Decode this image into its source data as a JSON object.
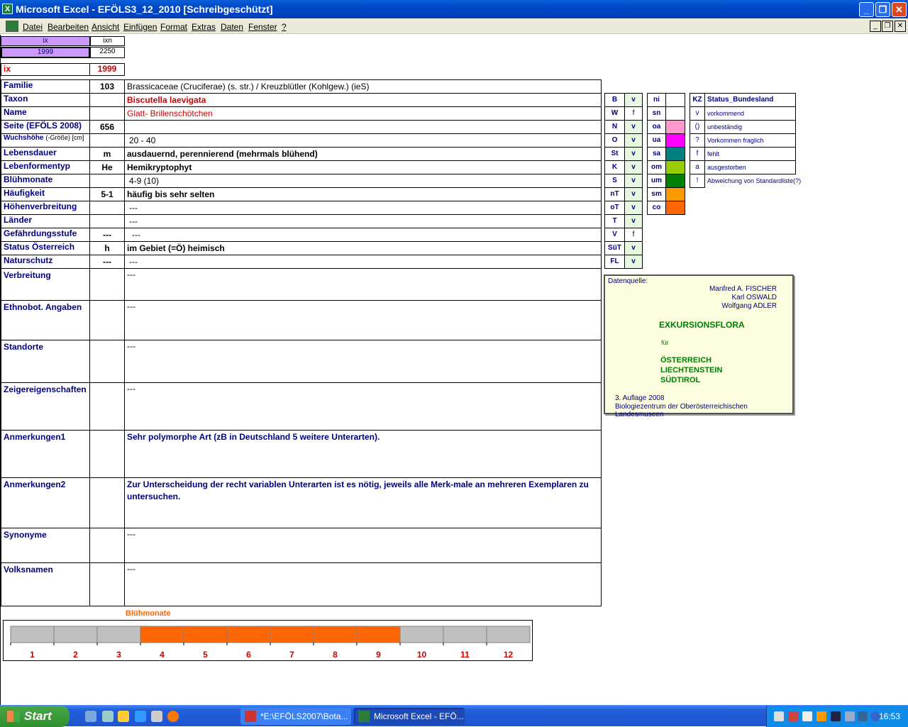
{
  "window": {
    "title": "Microsoft Excel - EFÖLS3_12_2010  [Schreibgeschützt]"
  },
  "menu": [
    "Datei",
    "Bearbeiten",
    "Ansicht",
    "Einfügen",
    "Format",
    "Extras",
    "Daten",
    "Fenster",
    "?"
  ],
  "header": {
    "ix_label": "ix",
    "ixn_label": "ixn",
    "ix_value": "1999",
    "ixn_value": "2250",
    "ix_big_label": "ix",
    "ix_big_value": "1999"
  },
  "rows": [
    {
      "label": "Familie",
      "code": "103",
      "value": "Brassicaceae (Cruciferae) (s. str.)  /  Kreuzblütler (Kohlgew.) (ieS)"
    },
    {
      "label": "Taxon",
      "code": "",
      "value": "Biscutella laevigata"
    },
    {
      "label": "Name",
      "code": "",
      "value": "Glatt- Brillenschötchen"
    },
    {
      "label": "Seite (EFÖLS 2008)",
      "code": "656",
      "value": ""
    },
    {
      "label": "Wuchshöhe",
      "label_suffix": "(-Größe) [cm]",
      "code": "",
      "value": "20 - 40"
    },
    {
      "label": "Lebensdauer",
      "code": "m",
      "value": "ausdauernd, perennierend (mehrmals blühend)"
    },
    {
      "label": "Lebenformentyp",
      "code": "He",
      "value": "Hemikryptophyt"
    },
    {
      "label": "Blühmonate",
      "code": "",
      "value": "4-9 (10)"
    },
    {
      "label": "Häufigkeit",
      "code": "5-1",
      "value": "häufig bis sehr selten"
    },
    {
      "label": "Höhenverbreitung",
      "code": "",
      "value": "---"
    },
    {
      "label": "Länder",
      "code": "",
      "value": "---"
    },
    {
      "label": "Gefährdungsstufe",
      "code": "---",
      "value": "---"
    },
    {
      "label": "Status Österreich",
      "code": "h",
      "value": "im Gebiet (=Ö) heimisch"
    },
    {
      "label": "Naturschutz",
      "code": "---",
      "value": "---"
    },
    {
      "label": "Verbreitung",
      "code": "",
      "value": "---"
    },
    {
      "label": "Ethnobot. Angaben",
      "code": "",
      "value": "---"
    },
    {
      "label": "Standorte",
      "code": "",
      "value": "---"
    },
    {
      "label": "Zeigereigenschaften",
      "code": "",
      "value": "---"
    },
    {
      "label": "Anmerkungen1",
      "code": "",
      "value": "Sehr polymorphe Art (zB in Deutschland 5 weitere Unterarten)."
    },
    {
      "label": "Anmerkungen2",
      "code": "",
      "value": "Zur Unterscheidung der recht variablen Unterarten ist es nötig, jeweils alle Merk-male an mehreren Exemplaren zu untersuchen."
    },
    {
      "label": "Synonyme",
      "code": "",
      "value": "---"
    },
    {
      "label": "Volksnamen",
      "code": "",
      "value": "---"
    }
  ],
  "states": [
    {
      "code": "B",
      "val": "v"
    },
    {
      "code": "W",
      "val": "f"
    },
    {
      "code": "N",
      "val": "v"
    },
    {
      "code": "O",
      "val": "v"
    },
    {
      "code": "St",
      "val": "v"
    },
    {
      "code": "K",
      "val": "v"
    },
    {
      "code": "S",
      "val": "v"
    },
    {
      "code": "nT",
      "val": "v"
    },
    {
      "code": "oT",
      "val": "v"
    },
    {
      "code": "T",
      "val": "v"
    },
    {
      "code": "V",
      "val": "f"
    },
    {
      "code": "SüT",
      "val": "v"
    },
    {
      "code": "FL",
      "val": "v"
    }
  ],
  "zones_header": "ni",
  "zones": [
    {
      "code": "sn",
      "color": "#ffffff"
    },
    {
      "code": "oa",
      "color": "#ff99cc"
    },
    {
      "code": "ua",
      "color": "#ff00ff"
    },
    {
      "code": "sa",
      "color": "#008080"
    },
    {
      "code": "om",
      "color": "#99cc00"
    },
    {
      "code": "um",
      "color": "#008000"
    },
    {
      "code": "sm",
      "color": "#ff9900"
    },
    {
      "code": "co",
      "color": "#ff6600"
    }
  ],
  "legend": {
    "kz_header": "KZ",
    "title": "Status_Bundesland",
    "items": [
      {
        "code": "v",
        "text": "vorkommend"
      },
      {
        "code": "()",
        "text": "unbeständig"
      },
      {
        "code": "?",
        "text": "Vorkommen fraglich"
      },
      {
        "code": "f",
        "text": "fehlt"
      },
      {
        "code": "a",
        "text": "ausgestorben"
      },
      {
        "code": "!",
        "text": "Abweichung von Standardliste(?)"
      }
    ]
  },
  "source": {
    "label": "Datenquelle:",
    "authors": [
      "Manfred A. FISCHER",
      "Karl OSWALD",
      "Wolfgang ADLER"
    ],
    "title": "EXKURSIONSFLORA",
    "fuer": "für",
    "countries": [
      "ÖSTERREICH",
      "LIECHTENSTEIN",
      "SÜDTIROL"
    ],
    "edition": "3. Auflage 2008",
    "publisher": "Biologiezentrum der Oberösterreichischen Landesmuseen"
  },
  "chart_data": {
    "type": "bar",
    "title": "Blühmonate",
    "categories": [
      "1",
      "2",
      "3",
      "4",
      "5",
      "6",
      "7",
      "8",
      "9",
      "10",
      "11",
      "12"
    ],
    "values": [
      0,
      0,
      0,
      1,
      1,
      1,
      1,
      1,
      1,
      0,
      0,
      0
    ],
    "colors": {
      "on": "#ff6600",
      "off": "#c0c0c0"
    }
  },
  "taskbar": {
    "start": "Start",
    "tasks": [
      "*E:\\EFÖLS2007\\Bota...",
      "Microsoft Excel - EFÖ..."
    ],
    "clock": "16:53"
  }
}
